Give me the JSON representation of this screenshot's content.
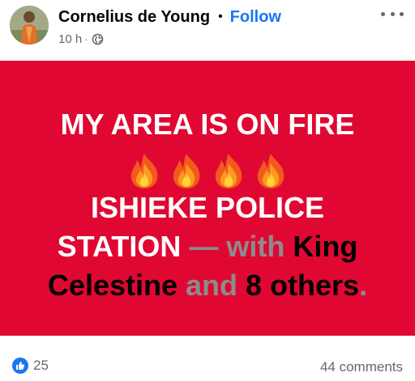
{
  "post": {
    "author": "Cornelius de Young",
    "separator": "•",
    "follow_label": "Follow",
    "timestamp": "10 h",
    "meta_dot": "·",
    "privacy_icon": "globe-icon",
    "more_icon": "more-options-icon"
  },
  "banner": {
    "background_color": "#e00832",
    "line1": "MY AREA IS ON FIRE",
    "fire_emoji_count": 4,
    "line3": "ISHIEKE POLICE",
    "line4_part1": "STATION",
    "line4_part2": " — with ",
    "line4_part3": "King",
    "line5_part1": "Celestine",
    "line5_part2": " and ",
    "line5_part3": "8 others",
    "line5_part4": "."
  },
  "footer": {
    "like_icon": "like-icon",
    "reaction_count": "25",
    "comments": "44 comments"
  }
}
